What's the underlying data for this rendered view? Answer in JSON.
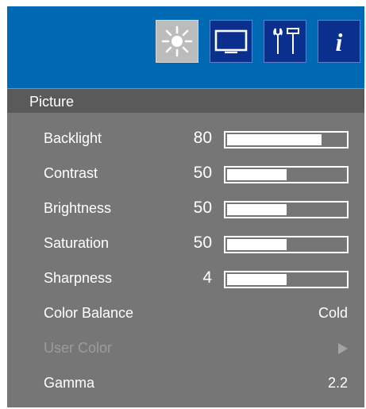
{
  "menu": {
    "tabs": [
      {
        "name": "picture",
        "icon": "sun-icon",
        "active": true
      },
      {
        "name": "display",
        "icon": "monitor-icon",
        "active": false
      },
      {
        "name": "setup",
        "icon": "tools-icon",
        "active": false
      },
      {
        "name": "information",
        "icon": "info-icon",
        "active": false
      }
    ],
    "section_title": "Picture",
    "items": [
      {
        "label": "Backlight",
        "value": "80",
        "level": 0.8
      },
      {
        "label": "Contrast",
        "value": "50",
        "level": 0.5
      },
      {
        "label": "Brightness",
        "value": "50",
        "level": 0.5
      },
      {
        "label": "Saturation",
        "value": "50",
        "level": 0.5
      },
      {
        "label": "Sharpness",
        "value": "4",
        "level": 0.5
      },
      {
        "label": "Color Balance",
        "setting": "Cold"
      },
      {
        "label": "User Color",
        "disabled": true,
        "submenu": true
      },
      {
        "label": "Gamma",
        "setting": "2.2"
      }
    ]
  },
  "colors": {
    "topbar": "#0069b4",
    "tab_inactive": "#0a2f8c",
    "tab_active": "#bcbcbc",
    "panel": "#767676",
    "header": "#5a5a5a",
    "disabled_text": "#9c9c9c"
  }
}
